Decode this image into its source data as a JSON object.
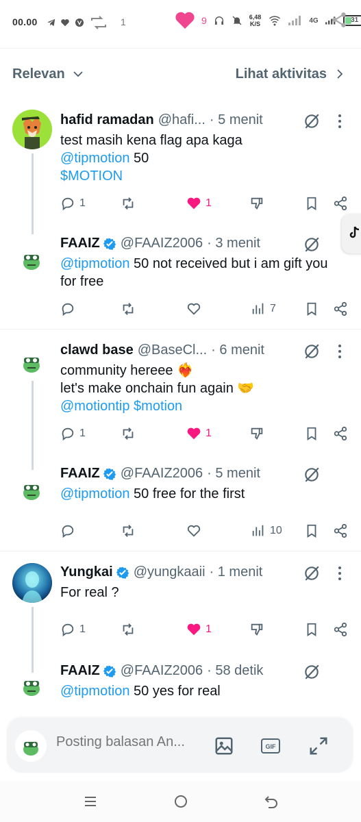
{
  "status_bar": {
    "time": "00.00",
    "notif_count": "1",
    "alarm_count": "9",
    "net_speed_value": "6,48",
    "net_speed_unit": "K/S",
    "network": "4G",
    "battery": "31"
  },
  "sort": {
    "label": "Relevan",
    "activity_label": "Lihat aktivitas"
  },
  "threads": [
    {
      "parent": {
        "name": "hafid ramadan",
        "handle": "@hafi...",
        "time": "· 5 menit",
        "verified": false,
        "body": [
          "test masih kena flag apa kaga",
          "@tipmotion",
          "50",
          "$MOTION"
        ],
        "replies": "1",
        "likes": "1",
        "liked": true
      },
      "reply": {
        "name": "FAAIZ",
        "handle": "@FAAIZ2006",
        "time": "· 3 menit",
        "verified": true,
        "mention": "@tipmotion",
        "text": " 50 not received but i am gift you for free",
        "views": "7"
      }
    },
    {
      "parent": {
        "name": "clawd base",
        "handle": "@BaseCl...",
        "time": "· 6 menit",
        "verified": false,
        "line1": "community hereee ❤️‍🔥",
        "line2": "let's make onchain fun again 🤝",
        "mention": "@motiontip",
        "tag": "$motion",
        "replies": "1",
        "likes": "1",
        "liked": true
      },
      "reply": {
        "name": "FAAIZ",
        "handle": "@FAAIZ2006",
        "time": "· 5 menit",
        "verified": true,
        "mention": "@tipmotion",
        "text": " 50 free for the first",
        "views": "10"
      }
    },
    {
      "parent": {
        "name": "Yungkai",
        "handle": "@yungkaaii",
        "time": "· 1 menit",
        "verified": true,
        "text": "For real ?",
        "replies": "1",
        "likes": "1",
        "liked": true
      },
      "reply": {
        "name": "FAAIZ",
        "handle": "@FAAIZ2006",
        "time": "· 58 detik",
        "verified": true,
        "mention": "@tipmotion",
        "text": " 50 yes for real"
      }
    }
  ],
  "reply_bar": {
    "placeholder": "Posting balasan An..."
  },
  "colors": {
    "link": "#1d9bf0",
    "like": "#f91880",
    "verified": "#1d9bf0",
    "muted": "#536471",
    "thread_line": "#cfd9de"
  }
}
